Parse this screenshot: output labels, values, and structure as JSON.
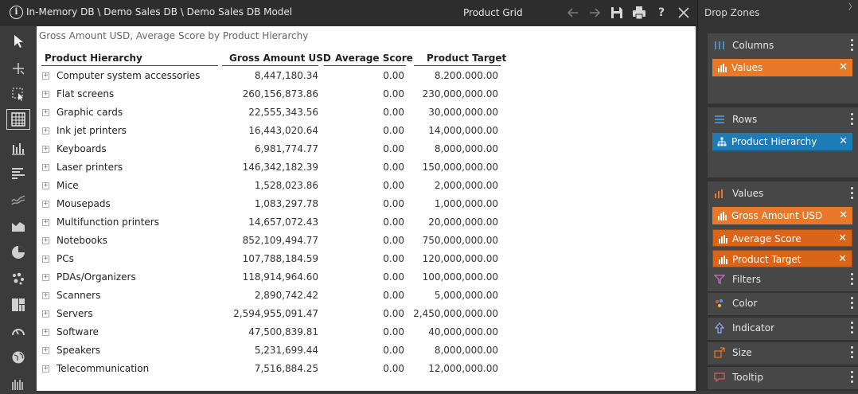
{
  "titlebar": {
    "path": "In-Memory DB \\ Demo Sales DB \\ Demo Sales DB Model",
    "title": "Product Grid",
    "buttons": [
      "back-arrow-icon",
      "forward-arrow-icon",
      "save-icon",
      "print-icon",
      "help-icon",
      "close-icon"
    ],
    "help_label": "?"
  },
  "toolbar": {
    "tools": [
      "select-arrow-icon",
      "crosshair-icon",
      "selection-box-icon",
      "grid-icon",
      "column-chart-icon",
      "bar-chart-icon",
      "line-chart-icon",
      "area-chart-icon",
      "pie-chart-icon",
      "scatter-icon",
      "treemap-icon",
      "gauge-icon",
      "globe-icon",
      "sunburst-icon"
    ],
    "active": "grid-icon"
  },
  "grid": {
    "title": "Gross Amount USD, Average Score by Product Hierarchy",
    "columns": [
      "Product Hierarchy",
      "Gross Amount USD",
      "Average Score",
      "Product Target"
    ],
    "rows": [
      {
        "name": "Computer system accessories",
        "gross": "8,447,180.34",
        "avg": "0.00",
        "target": "8.200.000.00"
      },
      {
        "name": "Flat screens",
        "gross": "260,156,873.86",
        "avg": "0.00",
        "target": "230,000,000.00"
      },
      {
        "name": "Graphic cards",
        "gross": "22,555,343.56",
        "avg": "0.00",
        "target": "30,000,000.00"
      },
      {
        "name": "Ink jet printers",
        "gross": "16,443,020.64",
        "avg": "0.00",
        "target": "14,000,000.00"
      },
      {
        "name": "Keyboards",
        "gross": "6,981,774.77",
        "avg": "0.00",
        "target": "8,000,000.00"
      },
      {
        "name": "Laser printers",
        "gross": "146,342,182.39",
        "avg": "0.00",
        "target": "150,000,000.00"
      },
      {
        "name": "Mice",
        "gross": "1,528,023.86",
        "avg": "0.00",
        "target": "2,000,000.00"
      },
      {
        "name": "Mousepads",
        "gross": "1,083,297.78",
        "avg": "0.00",
        "target": "1,000,000.00"
      },
      {
        "name": "Multifunction printers",
        "gross": "14,657,072.43",
        "avg": "0.00",
        "target": "20,000,000.00"
      },
      {
        "name": "Notebooks",
        "gross": "852,109,494.77",
        "avg": "0.00",
        "target": "750,000,000.00"
      },
      {
        "name": "PCs",
        "gross": "107,788,184.59",
        "avg": "0.00",
        "target": "120,000,000.00"
      },
      {
        "name": "PDAs/Organizers",
        "gross": "118,914,964.60",
        "avg": "0.00",
        "target": "100,000,000.00"
      },
      {
        "name": "Scanners",
        "gross": "2,890,742.42",
        "avg": "0.00",
        "target": "5,000,000.00"
      },
      {
        "name": "Servers",
        "gross": "2,594,955,091.47",
        "avg": "0.00",
        "target": "2,450,000,000.00"
      },
      {
        "name": "Software",
        "gross": "47,500,839.81",
        "avg": "0.00",
        "target": "40,000,000.00"
      },
      {
        "name": "Speakers",
        "gross": "5,231,699.44",
        "avg": "0.00",
        "target": "8,000,000.00"
      },
      {
        "name": "Telecommunication",
        "gross": "7,516,884.25",
        "avg": "0.00",
        "target": "12,000,000.00"
      }
    ]
  },
  "dropzones": {
    "title": "Drop Zones",
    "columns": {
      "label": "Columns",
      "icon": "columns-icon",
      "items": [
        {
          "label": "Values",
          "icon": "bar-chart-icon",
          "close": "✕"
        }
      ]
    },
    "rows": {
      "label": "Rows",
      "icon": "rows-icon",
      "items": [
        {
          "label": "Product Hierarchy",
          "icon": "hierarchy-icon",
          "close": "✕"
        }
      ]
    },
    "values": {
      "label": "Values",
      "icon": "values-icon",
      "items": [
        {
          "label": "Gross Amount USD",
          "icon": "bar-chart-icon",
          "close": "✕"
        },
        {
          "label": "Average Score",
          "icon": "bar-chart-icon",
          "close": "✕"
        },
        {
          "label": "Product Target",
          "icon": "bar-chart-icon",
          "close": "✕"
        }
      ]
    },
    "filters": {
      "label": "Filters",
      "icon": "filter-icon"
    },
    "color": {
      "label": "Color",
      "icon": "color-palette-icon"
    },
    "indicator": {
      "label": "Indicator",
      "icon": "indicator-arrow-icon"
    },
    "size": {
      "label": "Size",
      "icon": "size-icon"
    },
    "tooltip": {
      "label": "Tooltip",
      "icon": "tooltip-icon"
    }
  },
  "colors": {
    "accent_orange": "#e8792b",
    "accent_blue": "#1d7bb5",
    "panel": "#333333",
    "zone": "#474747"
  }
}
